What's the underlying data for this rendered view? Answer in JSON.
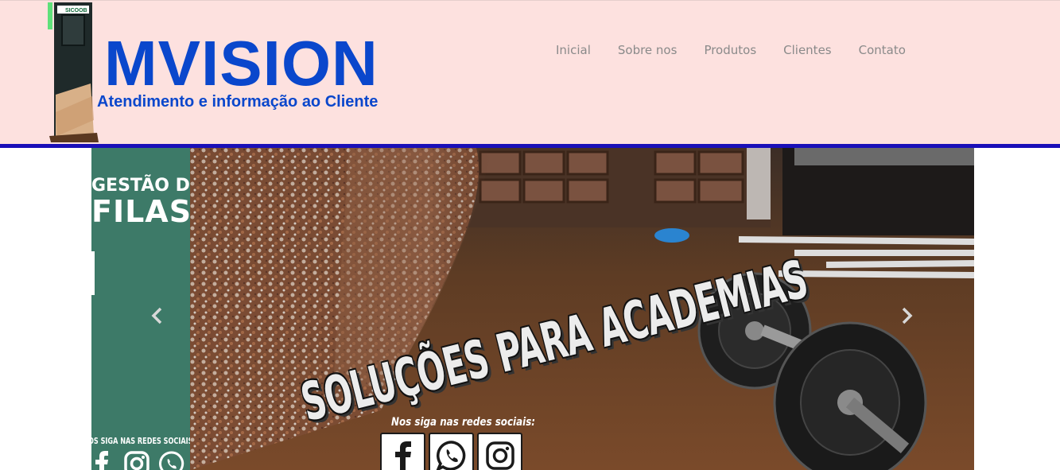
{
  "header": {
    "brand": "MVISION",
    "tagline": "Atendimento e informação ao Cliente",
    "kiosk_label": "SICOOB",
    "background": "#fde1df",
    "accent": "#1a0fb8",
    "brand_color": "#0a47cc"
  },
  "nav": {
    "items": [
      {
        "label": "Inicial"
      },
      {
        "label": "Sobre nos"
      },
      {
        "label": "Produtos"
      },
      {
        "label": "Clientes"
      },
      {
        "label": "Contato"
      }
    ]
  },
  "carousel": {
    "side_panel": {
      "title_line1": "GESTÃO DE",
      "title_line2": "FILAS",
      "social_text": "OS SIGA NAS REDES SOCIAIS",
      "icons": [
        "facebook-icon",
        "instagram-icon",
        "whatsapp-icon"
      ],
      "color": "#3d7a68"
    },
    "slide": {
      "headline": "SOLUÇÕES PARA ACADEMIAS",
      "follow_text": "Nos siga nas redes sociais:",
      "icons": [
        "facebook-icon",
        "whatsapp-icon",
        "instagram-icon"
      ]
    },
    "controls": {
      "prev_icon": "chevron-left-icon",
      "next_icon": "chevron-right-icon"
    }
  }
}
